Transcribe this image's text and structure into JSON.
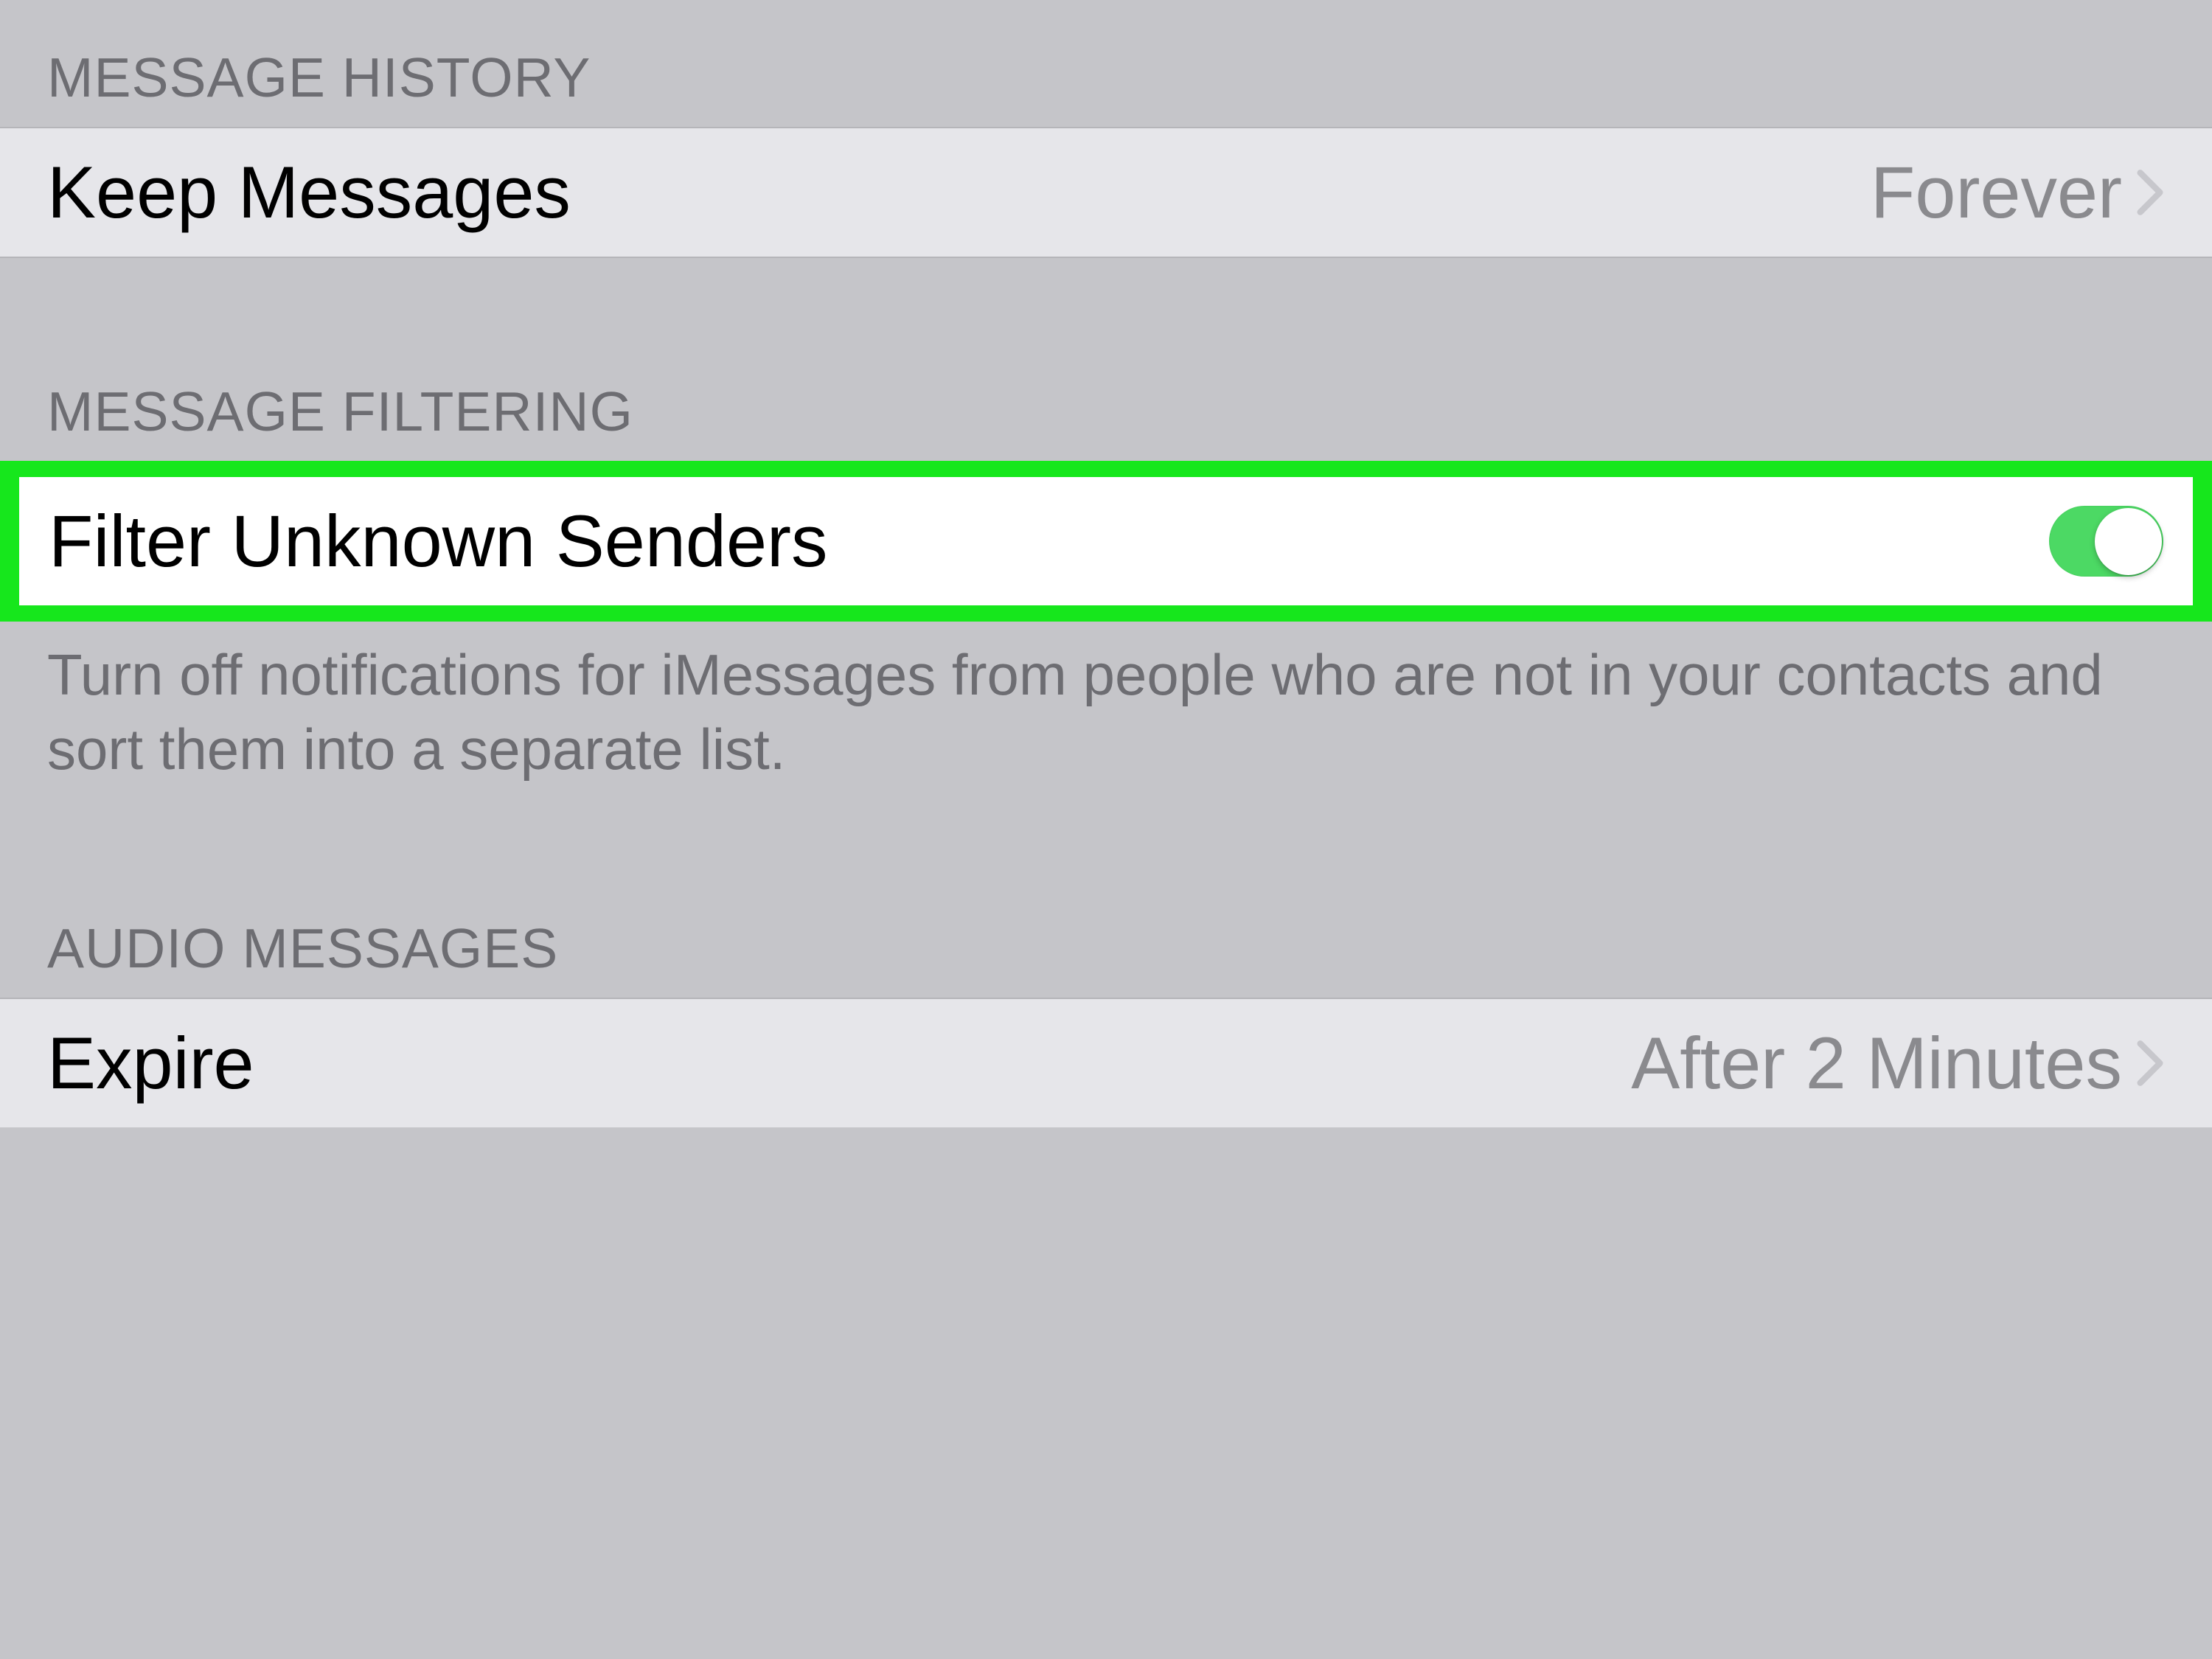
{
  "sections": {
    "message_history": {
      "header": "MESSAGE HISTORY",
      "keep_messages": {
        "label": "Keep Messages",
        "value": "Forever"
      }
    },
    "message_filtering": {
      "header": "MESSAGE FILTERING",
      "filter_unknown": {
        "label": "Filter Unknown Senders",
        "toggle_on": true
      },
      "footer": "Turn off notifications for iMessages from people who are not in your contacts and sort them into a separate list."
    },
    "audio_messages": {
      "header": "AUDIO MESSAGES",
      "expire": {
        "label": "Expire",
        "value": "After 2 Minutes"
      }
    }
  }
}
